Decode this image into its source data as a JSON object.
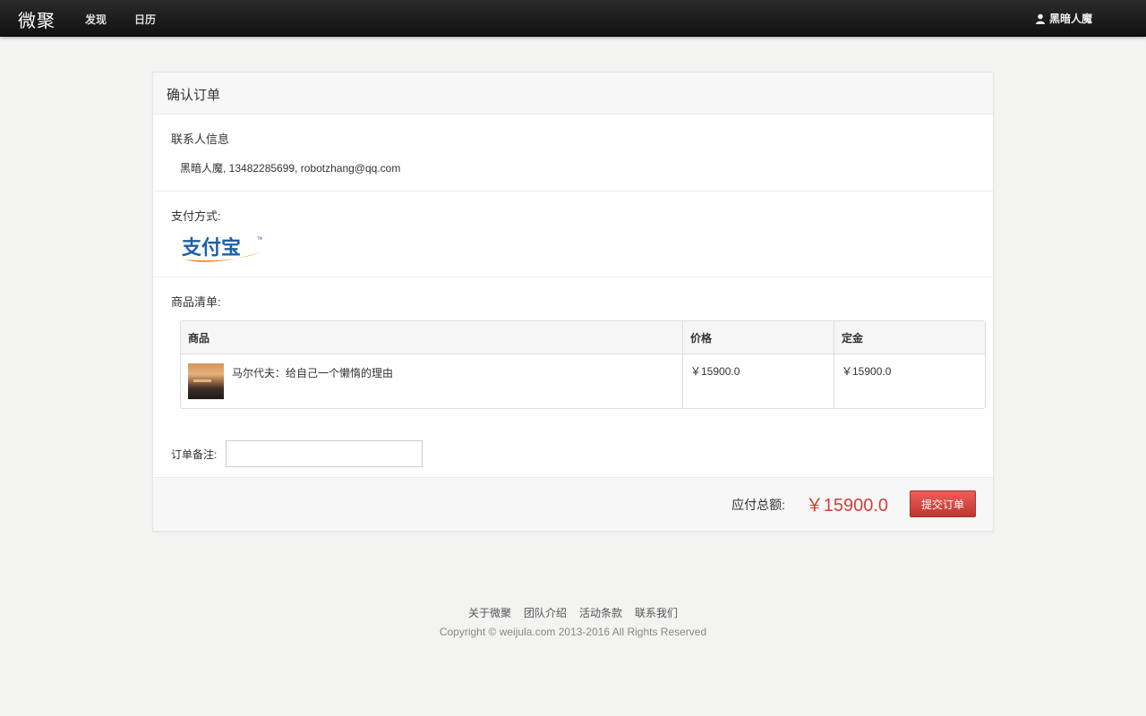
{
  "navbar": {
    "brand": "微聚",
    "links": [
      "发现",
      "日历"
    ],
    "user_name": "黑暗人魔",
    "user_icon": "user-icon"
  },
  "panel": {
    "title": "确认订单",
    "contact": {
      "title": "联系人信息",
      "info": "黑暗人魔, 13482285699, robotzhang@qq.com"
    },
    "payment": {
      "title": "支付方式:",
      "method_logo_text": "支付宝"
    },
    "goods": {
      "title": "商品清单:",
      "headers": [
        "商品",
        "价格",
        "定金"
      ],
      "rows": [
        {
          "name": "马尔代夫：给自己一个懒惰的理由",
          "price": "￥15900.0",
          "deposit": "￥15900.0"
        }
      ]
    },
    "remark": {
      "label": "订单备注:",
      "value": "",
      "placeholder": ""
    },
    "footer": {
      "total_label": "应付总额:",
      "total_value": "￥15900.0",
      "submit_label": "提交订单"
    }
  },
  "footer": {
    "links": [
      "关于微聚",
      "团队介绍",
      "活动条款",
      "联系我们"
    ],
    "copyright": "Copyright © weijula.com 2013-2016 All Rights Reserved"
  },
  "colors": {
    "navbar_bg": "#1b1b1b",
    "accent_red": "#d43f3a",
    "page_bg": "#f3f3f2"
  }
}
